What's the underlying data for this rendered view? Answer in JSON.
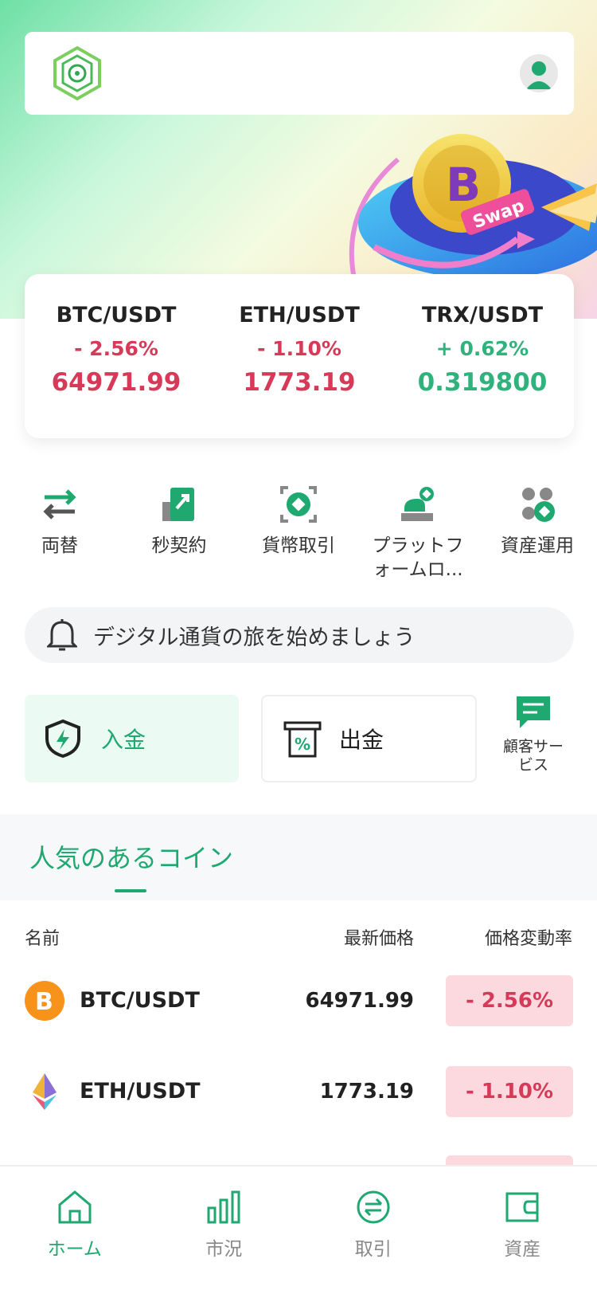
{
  "header": {
    "logo_icon": "hexagon-logo-icon",
    "avatar_icon": "user-avatar-icon"
  },
  "hero": {
    "badge_text": "Swap"
  },
  "tickers": [
    {
      "pair": "BTC/USDT",
      "change": "- 2.56%",
      "price": "64971.99",
      "trend": "down"
    },
    {
      "pair": "ETH/USDT",
      "change": "- 1.10%",
      "price": "1773.19",
      "trend": "down"
    },
    {
      "pair": "TRX/USDT",
      "change": "+ 0.62%",
      "price": "0.319800",
      "trend": "up"
    }
  ],
  "quick_menu": [
    {
      "label": "両替",
      "icon": "exchange-arrows-icon"
    },
    {
      "label": "秒契約",
      "icon": "contract-icon"
    },
    {
      "label": "貨幣取引",
      "icon": "currency-trade-icon"
    },
    {
      "label": "プラットフォームロ...",
      "icon": "platform-icon"
    },
    {
      "label": "資産運用",
      "icon": "asset-management-icon"
    }
  ],
  "notice": {
    "text": "デジタル通貨の旅を始めましょう",
    "icon": "bell-icon"
  },
  "actions": {
    "deposit_label": "入金",
    "withdraw_label": "出金",
    "customer_service_label": "顧客サービス",
    "cs_line1": "顧客サー",
    "cs_line2": "ビス"
  },
  "popular": {
    "title": "人気のあるコイン",
    "columns": {
      "name": "名前",
      "price": "最新価格",
      "change": "価格変動率"
    },
    "rows": [
      {
        "name": "BTC/USDT",
        "price": "64971.99",
        "change": "- 2.56%",
        "icon": "bitcoin-icon"
      },
      {
        "name": "ETH/USDT",
        "price": "1773.19",
        "change": "- 1.10%",
        "icon": "ethereum-icon"
      }
    ]
  },
  "bottom_nav": [
    {
      "label": "ホーム",
      "icon": "home-icon",
      "active": true
    },
    {
      "label": "市況",
      "icon": "bar-chart-icon",
      "active": false
    },
    {
      "label": "取引",
      "icon": "trade-icon",
      "active": false
    },
    {
      "label": "資産",
      "icon": "wallet-icon",
      "active": false
    }
  ],
  "colors": {
    "accent": "#1fa971",
    "down": "#d63a58",
    "up": "#2fb27b",
    "down_bg": "#fbd9df"
  }
}
